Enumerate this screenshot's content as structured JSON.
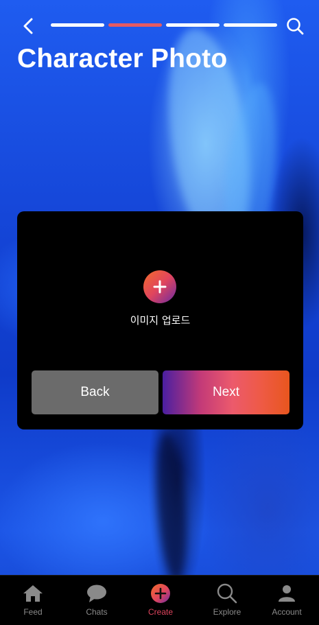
{
  "header": {
    "title": "Character Photo",
    "back_icon": "chevron-left-icon",
    "search_icon": "search-icon",
    "progress": {
      "steps": 4,
      "current": 2,
      "active_color": "#e65a62",
      "inactive_color": "#ffffff"
    }
  },
  "card": {
    "upload_icon": "plus-icon",
    "upload_label": "이미지 업로드",
    "back_label": "Back",
    "next_label": "Next",
    "back_color": "#6b6b6b",
    "next_gradient": [
      "#4a1fa0",
      "#ec5a6c",
      "#e8561e"
    ]
  },
  "bottom_nav": {
    "active_color": "#e0455e",
    "items": [
      {
        "label": "Feed",
        "icon": "home-icon"
      },
      {
        "label": "Chats",
        "icon": "chat-bubble-icon"
      },
      {
        "label": "Create",
        "icon": "plus-circle-icon",
        "active": true
      },
      {
        "label": "Explore",
        "icon": "search-icon"
      },
      {
        "label": "Account",
        "icon": "user-icon"
      }
    ]
  }
}
